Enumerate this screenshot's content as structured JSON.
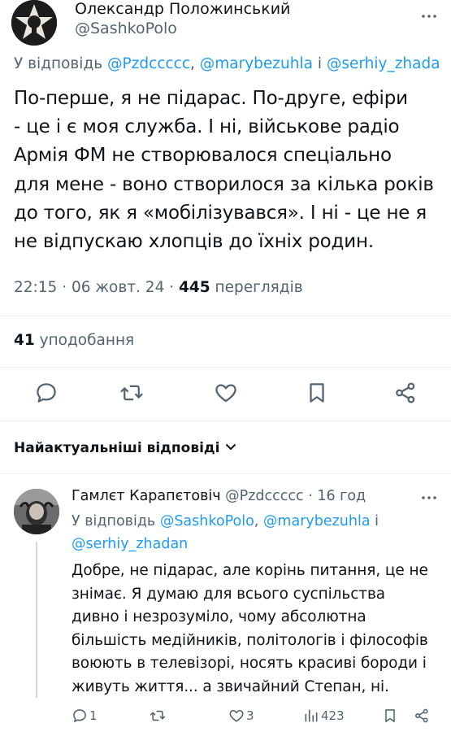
{
  "main_tweet": {
    "author_name": "Олександр Положинський",
    "author_handle": "@SashkoPolo",
    "reply_prefix": "У відповідь ",
    "reply_to": [
      "@Pzdccccc",
      "@marybezuhla",
      "@serhiy_zhada"
    ],
    "reply_sep_1": ", ",
    "reply_sep_2": " і ",
    "text_lines": [
      "По-перше, я не підарас. По-друге, ефіри",
      "- це і є моя служба. І ні, військове радіо",
      "Армія ФМ не створювалося спеціально",
      "для мене - воно створилося за кілька років",
      "до того, як я «мобілізувався». І ні - це не я",
      "не відпускаю хлопців до їхніх родин."
    ],
    "time": "22:15 · 06 жовт. 24 · ",
    "views_count": "445",
    "views_label": " переглядів",
    "likes_count": "41",
    "likes_label": " уподобання"
  },
  "actions": {
    "reply_icon": "reply-icon",
    "retweet_icon": "retweet-icon",
    "like_icon": "heart-icon",
    "bookmark_icon": "bookmark-icon",
    "share_icon": "share-icon"
  },
  "replies_section": {
    "title": "Найактуальніші відповіді"
  },
  "reply_tweet": {
    "author_name": "Гамлєт Карапєтовіч",
    "author_handle": "@Pzdccccc",
    "time": " · 16 год",
    "reply_prefix": "У відповідь ",
    "reply_to": [
      "@SashkoPolo",
      "@marybezuhla",
      "@serhiy_zhadan"
    ],
    "reply_sep_1": ", ",
    "reply_sep_2": " і",
    "text_lines": [
      "Добре, не підарас, але корінь питання, це не",
      "знімає. Я думаю для всього суспільства",
      "дивно і незрозуміло, чому абсолютна",
      "більшість медійників, політологів і філософів",
      "воюють в телевізорі, носять красиві бороди і",
      "живуть життя... а звичайний Степан, ні."
    ],
    "reply_count": "1",
    "retweet_count": "",
    "like_count": "3",
    "views_count": "423"
  },
  "colors": {
    "link": "#1d9bf0",
    "muted": "#536471",
    "text": "#0f1419",
    "divider": "#eff3f4"
  }
}
